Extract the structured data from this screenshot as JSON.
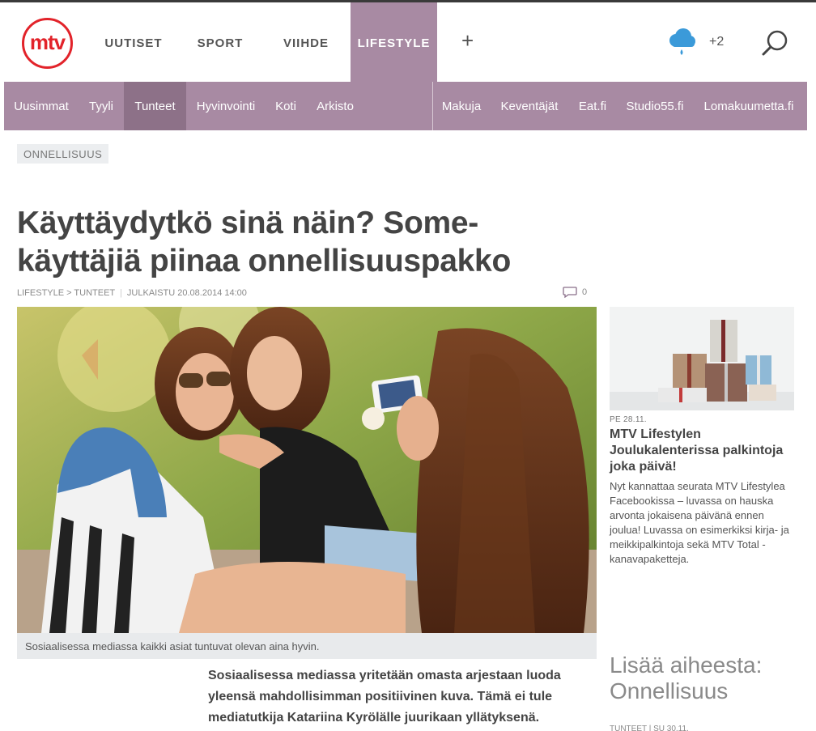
{
  "header": {
    "logo_text": "mtv",
    "nav": [
      "UUTISET",
      "SPORT",
      "VIIHDE",
      "LIFESTYLE"
    ],
    "active_nav": "LIFESTYLE",
    "more_label": "+",
    "weather": {
      "icon": "rain-cloud-icon",
      "temp": "+2"
    },
    "colors": {
      "brand_red": "#e2232a",
      "lifestyle_purple": "#a88aa3",
      "subnav_active": "#8d7188"
    }
  },
  "subnav": {
    "left": [
      "Uusimmat",
      "Tyyli",
      "Tunteet",
      "Hyvinvointi",
      "Koti",
      "Arkisto"
    ],
    "active": "Tunteet",
    "right": [
      "Makuja",
      "Keventäjät",
      "Eat.fi",
      "Studio55.fi",
      "Lomakuumetta.fi"
    ]
  },
  "article": {
    "tag": "ONNELLISUUS",
    "headline": "Käyttäydytkö sinä näin? Some-käyttäjiä piinaa onnellisuuspakko",
    "breadcrumb": "LIFESTYLE > TUNTEET",
    "published": "JULKAISTU 20.08.2014 14:00",
    "comment_count": "0",
    "image_caption": "Sosiaalisessa mediassa kaikki asiat tuntuvat olevan aina hyvin.",
    "lead": "Sosiaalisessa mediassa yritetään omasta arjestaan luoda yleensä mahdollisimman positiivinen kuva. Tämä ei tule mediatutkija Katariina Kyrölälle juurikaan yllätyksenä."
  },
  "sidebar": {
    "promo": {
      "date": "PE 28.11.",
      "title": "MTV Lifestylen Joulukalenterissa palkintoja joka päivä!",
      "text": "Nyt kannattaa seurata MTV Lifestylea Facebookissa – luvassa on hauska arvonta jokaisena päivänä ennen joulua! Luvassa on esimerkiksi kirja- ja meikkipalkintoja sekä MTV Total -kanavapaketteja."
    },
    "more": {
      "title": "Lisää aiheesta: Onnellisuus",
      "meta": "TUNTEET | SU 30.11."
    }
  }
}
